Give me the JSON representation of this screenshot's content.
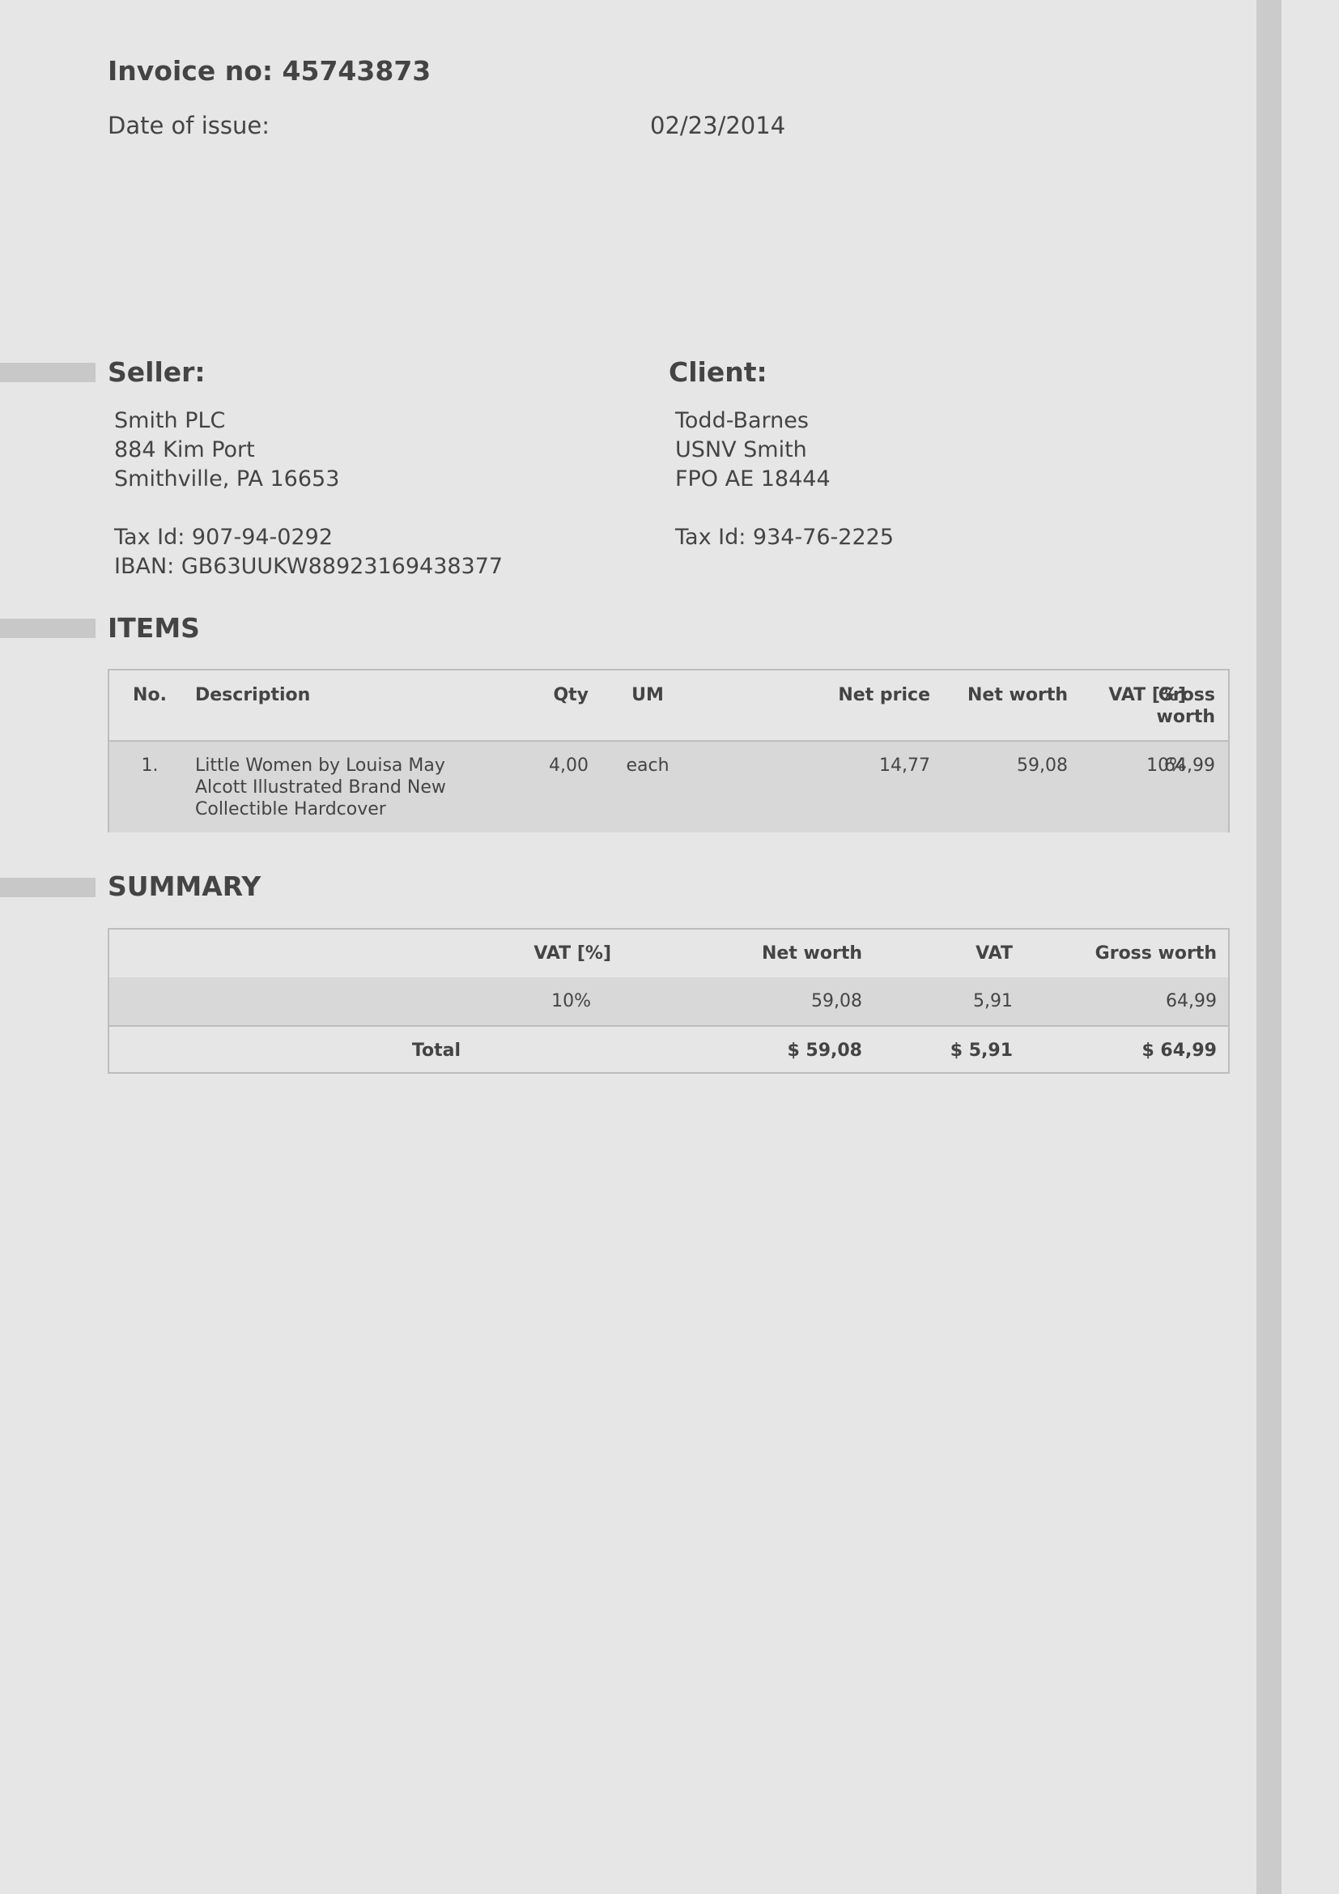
{
  "invoice": {
    "number_label": "Invoice no: 45743873",
    "date_label": "Date of issue:",
    "date_value": "02/23/2014"
  },
  "seller": {
    "title": "Seller:",
    "lines": [
      "Smith PLC",
      "884 Kim Port",
      "Smithville, PA 16653",
      "",
      "Tax Id: 907-94-0292",
      "IBAN: GB63UUKW88923169438377"
    ]
  },
  "client": {
    "title": "Client:",
    "lines": [
      "Todd-Barnes",
      "USNV Smith",
      "FPO AE 18444",
      "",
      "Tax Id: 934-76-2225"
    ]
  },
  "items": {
    "title": "ITEMS",
    "headers": {
      "no": "No.",
      "description": "Description",
      "qty": "Qty",
      "um": "UM",
      "net_price": "Net price",
      "net_worth": "Net worth",
      "vat": "VAT [%]",
      "gross_worth_1": "Gross",
      "gross_worth_2": "worth"
    },
    "rows": [
      {
        "no": "1.",
        "description_lines": [
          "Little Women by Louisa May",
          "Alcott Illustrated Brand New",
          "Collectible Hardcover"
        ],
        "qty": "4,00",
        "um": "each",
        "net_price": "14,77",
        "net_worth": "59,08",
        "vat": "10%",
        "gross_worth": "64,99"
      }
    ]
  },
  "summary": {
    "title": "SUMMARY",
    "headers": {
      "vat_rate": "VAT [%]",
      "net_worth": "Net worth",
      "vat": "VAT",
      "gross_worth": "Gross worth"
    },
    "rows": [
      {
        "vat_rate": "10%",
        "net_worth": "59,08",
        "vat": "5,91",
        "gross_worth": "64,99"
      }
    ],
    "total": {
      "label": "Total",
      "net_worth": "$ 59,08",
      "vat": "$ 5,91",
      "gross_worth": "$ 64,99"
    }
  },
  "colors": {
    "background": "#e6e6e6",
    "text": "#444444",
    "accent_bar": "#cbcbcb",
    "row_shade": "#d8d8d8",
    "border": "#bdbdbd"
  }
}
